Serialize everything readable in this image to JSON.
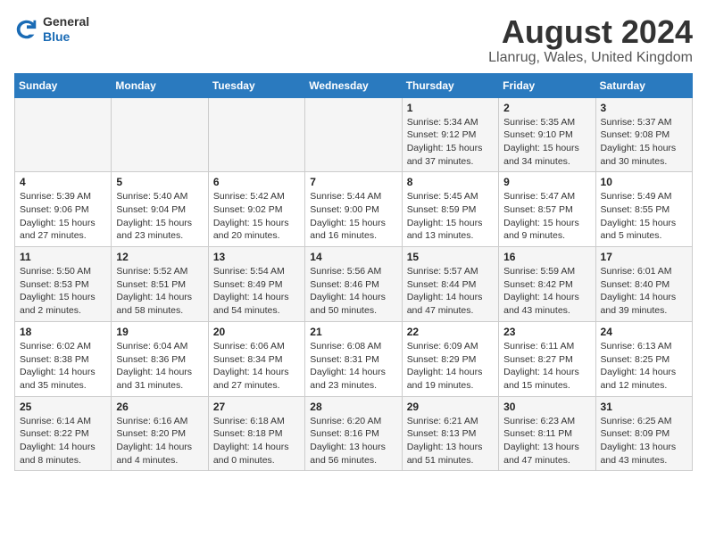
{
  "header": {
    "logo_line1": "General",
    "logo_line2": "Blue",
    "title": "August 2024",
    "subtitle": "Llanrug, Wales, United Kingdom"
  },
  "calendar": {
    "days_of_week": [
      "Sunday",
      "Monday",
      "Tuesday",
      "Wednesday",
      "Thursday",
      "Friday",
      "Saturday"
    ],
    "weeks": [
      [
        {
          "day": "",
          "info": ""
        },
        {
          "day": "",
          "info": ""
        },
        {
          "day": "",
          "info": ""
        },
        {
          "day": "",
          "info": ""
        },
        {
          "day": "1",
          "info": "Sunrise: 5:34 AM\nSunset: 9:12 PM\nDaylight: 15 hours\nand 37 minutes."
        },
        {
          "day": "2",
          "info": "Sunrise: 5:35 AM\nSunset: 9:10 PM\nDaylight: 15 hours\nand 34 minutes."
        },
        {
          "day": "3",
          "info": "Sunrise: 5:37 AM\nSunset: 9:08 PM\nDaylight: 15 hours\nand 30 minutes."
        }
      ],
      [
        {
          "day": "4",
          "info": "Sunrise: 5:39 AM\nSunset: 9:06 PM\nDaylight: 15 hours\nand 27 minutes."
        },
        {
          "day": "5",
          "info": "Sunrise: 5:40 AM\nSunset: 9:04 PM\nDaylight: 15 hours\nand 23 minutes."
        },
        {
          "day": "6",
          "info": "Sunrise: 5:42 AM\nSunset: 9:02 PM\nDaylight: 15 hours\nand 20 minutes."
        },
        {
          "day": "7",
          "info": "Sunrise: 5:44 AM\nSunset: 9:00 PM\nDaylight: 15 hours\nand 16 minutes."
        },
        {
          "day": "8",
          "info": "Sunrise: 5:45 AM\nSunset: 8:59 PM\nDaylight: 15 hours\nand 13 minutes."
        },
        {
          "day": "9",
          "info": "Sunrise: 5:47 AM\nSunset: 8:57 PM\nDaylight: 15 hours\nand 9 minutes."
        },
        {
          "day": "10",
          "info": "Sunrise: 5:49 AM\nSunset: 8:55 PM\nDaylight: 15 hours\nand 5 minutes."
        }
      ],
      [
        {
          "day": "11",
          "info": "Sunrise: 5:50 AM\nSunset: 8:53 PM\nDaylight: 15 hours\nand 2 minutes."
        },
        {
          "day": "12",
          "info": "Sunrise: 5:52 AM\nSunset: 8:51 PM\nDaylight: 14 hours\nand 58 minutes."
        },
        {
          "day": "13",
          "info": "Sunrise: 5:54 AM\nSunset: 8:49 PM\nDaylight: 14 hours\nand 54 minutes."
        },
        {
          "day": "14",
          "info": "Sunrise: 5:56 AM\nSunset: 8:46 PM\nDaylight: 14 hours\nand 50 minutes."
        },
        {
          "day": "15",
          "info": "Sunrise: 5:57 AM\nSunset: 8:44 PM\nDaylight: 14 hours\nand 47 minutes."
        },
        {
          "day": "16",
          "info": "Sunrise: 5:59 AM\nSunset: 8:42 PM\nDaylight: 14 hours\nand 43 minutes."
        },
        {
          "day": "17",
          "info": "Sunrise: 6:01 AM\nSunset: 8:40 PM\nDaylight: 14 hours\nand 39 minutes."
        }
      ],
      [
        {
          "day": "18",
          "info": "Sunrise: 6:02 AM\nSunset: 8:38 PM\nDaylight: 14 hours\nand 35 minutes."
        },
        {
          "day": "19",
          "info": "Sunrise: 6:04 AM\nSunset: 8:36 PM\nDaylight: 14 hours\nand 31 minutes."
        },
        {
          "day": "20",
          "info": "Sunrise: 6:06 AM\nSunset: 8:34 PM\nDaylight: 14 hours\nand 27 minutes."
        },
        {
          "day": "21",
          "info": "Sunrise: 6:08 AM\nSunset: 8:31 PM\nDaylight: 14 hours\nand 23 minutes."
        },
        {
          "day": "22",
          "info": "Sunrise: 6:09 AM\nSunset: 8:29 PM\nDaylight: 14 hours\nand 19 minutes."
        },
        {
          "day": "23",
          "info": "Sunrise: 6:11 AM\nSunset: 8:27 PM\nDaylight: 14 hours\nand 15 minutes."
        },
        {
          "day": "24",
          "info": "Sunrise: 6:13 AM\nSunset: 8:25 PM\nDaylight: 14 hours\nand 12 minutes."
        }
      ],
      [
        {
          "day": "25",
          "info": "Sunrise: 6:14 AM\nSunset: 8:22 PM\nDaylight: 14 hours\nand 8 minutes."
        },
        {
          "day": "26",
          "info": "Sunrise: 6:16 AM\nSunset: 8:20 PM\nDaylight: 14 hours\nand 4 minutes."
        },
        {
          "day": "27",
          "info": "Sunrise: 6:18 AM\nSunset: 8:18 PM\nDaylight: 14 hours\nand 0 minutes."
        },
        {
          "day": "28",
          "info": "Sunrise: 6:20 AM\nSunset: 8:16 PM\nDaylight: 13 hours\nand 56 minutes."
        },
        {
          "day": "29",
          "info": "Sunrise: 6:21 AM\nSunset: 8:13 PM\nDaylight: 13 hours\nand 51 minutes."
        },
        {
          "day": "30",
          "info": "Sunrise: 6:23 AM\nSunset: 8:11 PM\nDaylight: 13 hours\nand 47 minutes."
        },
        {
          "day": "31",
          "info": "Sunrise: 6:25 AM\nSunset: 8:09 PM\nDaylight: 13 hours\nand 43 minutes."
        }
      ]
    ]
  }
}
